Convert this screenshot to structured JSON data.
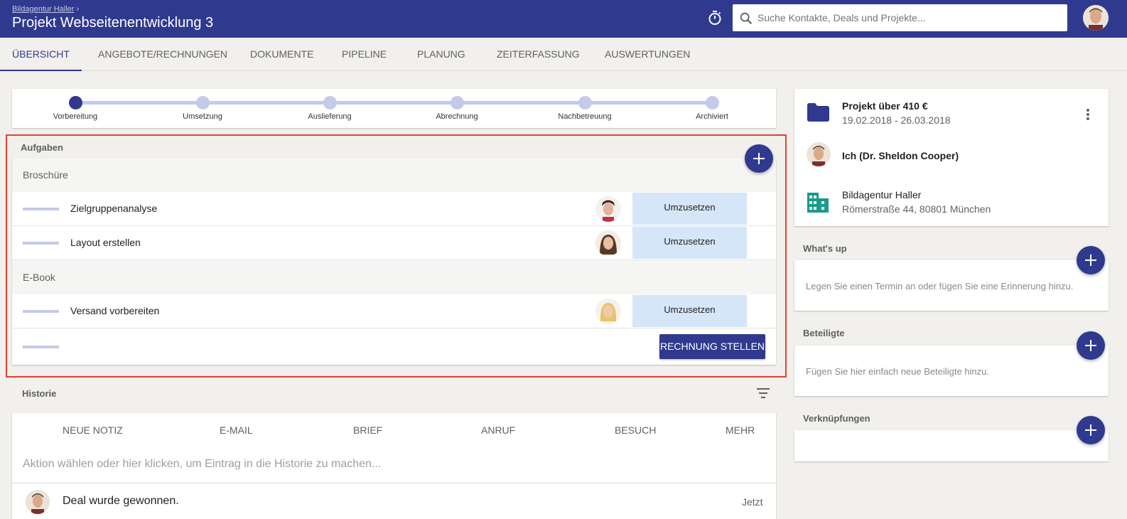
{
  "header": {
    "breadcrumb": "Bildagentur Haller",
    "breadcrumb_sep": "›",
    "title": "Projekt Webseitenentwicklung 3",
    "search_placeholder": "Suche Kontakte, Deals und Projekte...",
    "icons": [
      "stopwatch-icon",
      "search-icon",
      "user-avatar"
    ]
  },
  "tabs": [
    {
      "label": "Übersicht",
      "active": true
    },
    {
      "label": "Angebote/Rechnungen"
    },
    {
      "label": "Dokumente"
    },
    {
      "label": "Pipeline"
    },
    {
      "label": "Planung"
    },
    {
      "label": "Zeiterfassung"
    },
    {
      "label": "Auswertungen"
    }
  ],
  "stepper": {
    "steps": [
      "Vorbereitung",
      "Umsetzung",
      "Auslieferung",
      "Abrechnung",
      "Nachbetreuung",
      "Archiviert"
    ],
    "current": "Vorbereitung"
  },
  "tasks": {
    "label": "Aufgaben",
    "groups": [
      {
        "name": "Broschüre",
        "items": [
          {
            "name": "Zielgruppenanalyse",
            "status": "Umzusetzen"
          },
          {
            "name": "Layout erstellen",
            "status": "Umzusetzen"
          }
        ]
      },
      {
        "name": "E-Book",
        "items": [
          {
            "name": "Versand vorbereiten",
            "status": "Umzusetzen"
          }
        ]
      }
    ],
    "invoice_button": "Rechnung stellen"
  },
  "history": {
    "label": "Historie",
    "actions": [
      "Neue Notiz",
      "E-Mail",
      "Brief",
      "Anruf",
      "Besuch",
      "Mehr"
    ],
    "input_placeholder": "Aktion wählen oder hier klicken, um Eintrag in die Historie zu machen...",
    "entries": [
      {
        "text": "Deal wurde gewonnen.",
        "time": "Jetzt"
      }
    ]
  },
  "project_info": {
    "title": "Projekt über 410 €",
    "dates": "19.02.2018 - 26.03.2018",
    "owner": "Ich (Dr. Sheldon Cooper)",
    "company": "Bildagentur Haller",
    "address": "Römerstraße 44, 80801 München"
  },
  "whats_up": {
    "label": "What's up",
    "hint": "Legen Sie einen Termin an oder fügen Sie eine Erinnerung hinzu."
  },
  "participants": {
    "label": "Beteiligte",
    "hint": "Fügen Sie hier einfach neue Beteiligte hinzu."
  },
  "links": {
    "label": "Verknüpfungen"
  },
  "colors": {
    "primary": "#2f3a8f",
    "step_inactive": "#c5cae9",
    "status_bg": "#d4e6f7",
    "highlight": "#e53f2d",
    "building_icon": "#1a9a8a"
  }
}
